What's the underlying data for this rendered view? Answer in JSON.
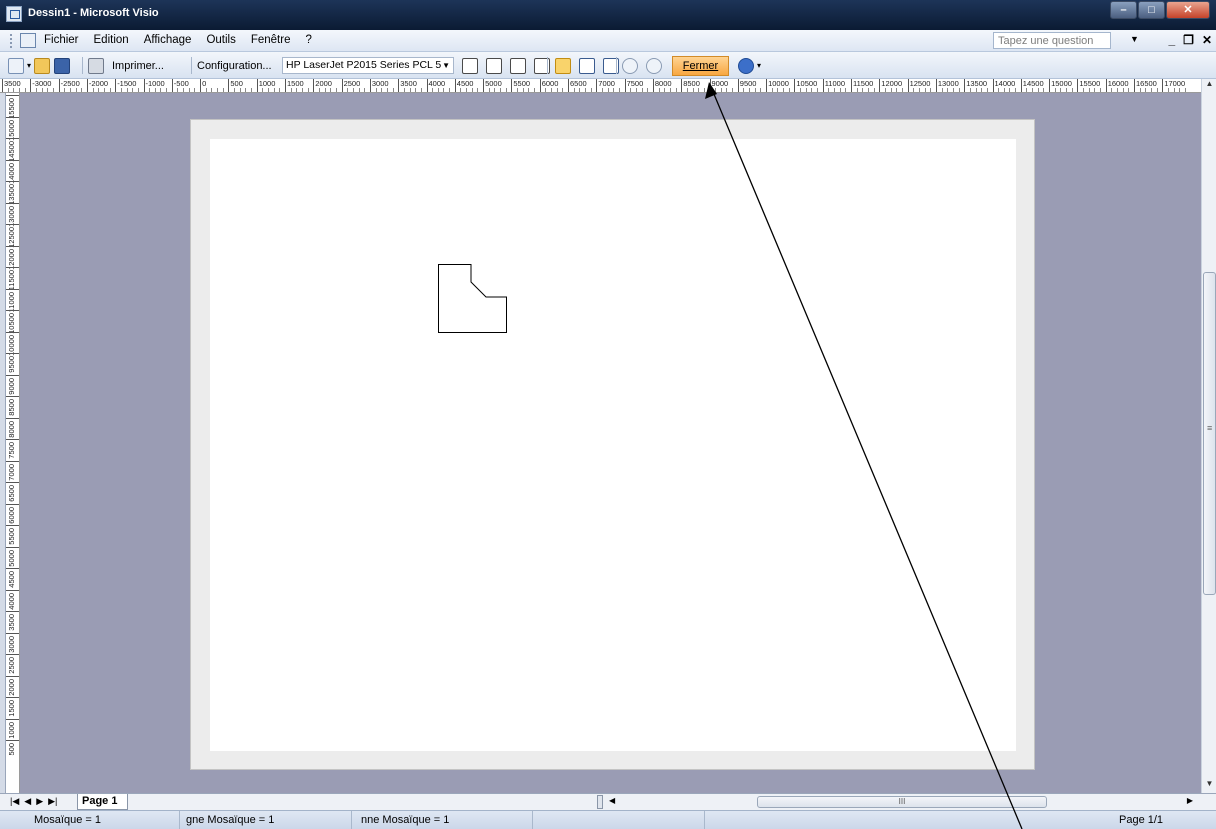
{
  "window": {
    "title": "Dessin1 - Microsoft Visio",
    "controls": [
      "minimize-icon",
      "maximize-icon",
      "close-icon"
    ]
  },
  "menubar": {
    "items": [
      {
        "name": "fichier",
        "label": "Fichier"
      },
      {
        "name": "edition",
        "label": "Edition"
      },
      {
        "name": "affichage",
        "label": "Affichage"
      },
      {
        "name": "outils",
        "label": "Outils"
      },
      {
        "name": "fenetre",
        "label": "Fenêtre"
      },
      {
        "name": "aide",
        "label": "?"
      }
    ],
    "question_placeholder": "Tapez une question"
  },
  "toolbar": {
    "print_label": "Imprimer...",
    "setup_label": "Configuration...",
    "printer_selected": "HP LaserJet P2015 Series PCL 5",
    "close_label": "Fermer"
  },
  "rulers": {
    "horizontal_labels": [
      "3500",
      "-3000",
      "-2500",
      "-2000",
      "-1500",
      "-1000",
      "-500",
      "0",
      "500",
      "1000",
      "1500",
      "2000",
      "2500",
      "3000",
      "3500",
      "4000",
      "4500",
      "5000",
      "5500",
      "6000",
      "6500",
      "7000",
      "7500",
      "8000",
      "8500",
      "9000",
      "9500",
      "10000",
      "10500",
      "11000",
      "11500",
      "12000",
      "12500",
      "13000",
      "13500",
      "14000",
      "14500",
      "15000",
      "15500",
      "16000",
      "16500",
      "17000"
    ],
    "vertical_labels": [
      "15500",
      "15000",
      "14500",
      "14000",
      "13500",
      "13000",
      "12500",
      "12000",
      "11500",
      "11000",
      "10500",
      "10000",
      "9500",
      "9000",
      "8500",
      "8000",
      "7500",
      "7000",
      "6500",
      "6000",
      "5500",
      "5000",
      "4500",
      "4000",
      "3500",
      "3000",
      "2500",
      "2000",
      "1500",
      "1000",
      "500"
    ]
  },
  "tabs": {
    "page_tab": "Page 1",
    "scroll_thumb": "III"
  },
  "statusbar": {
    "mosaic": "Mosaïque = 1",
    "row_mosaic": "gne Mosaïque = 1",
    "col_mosaic": "nne Mosaïque = 1",
    "page_indicator": "Page 1/1"
  },
  "colors": {
    "workspace": "#9a9cb4",
    "close_button": "#f8a742",
    "titlebar": "#1d3458"
  }
}
